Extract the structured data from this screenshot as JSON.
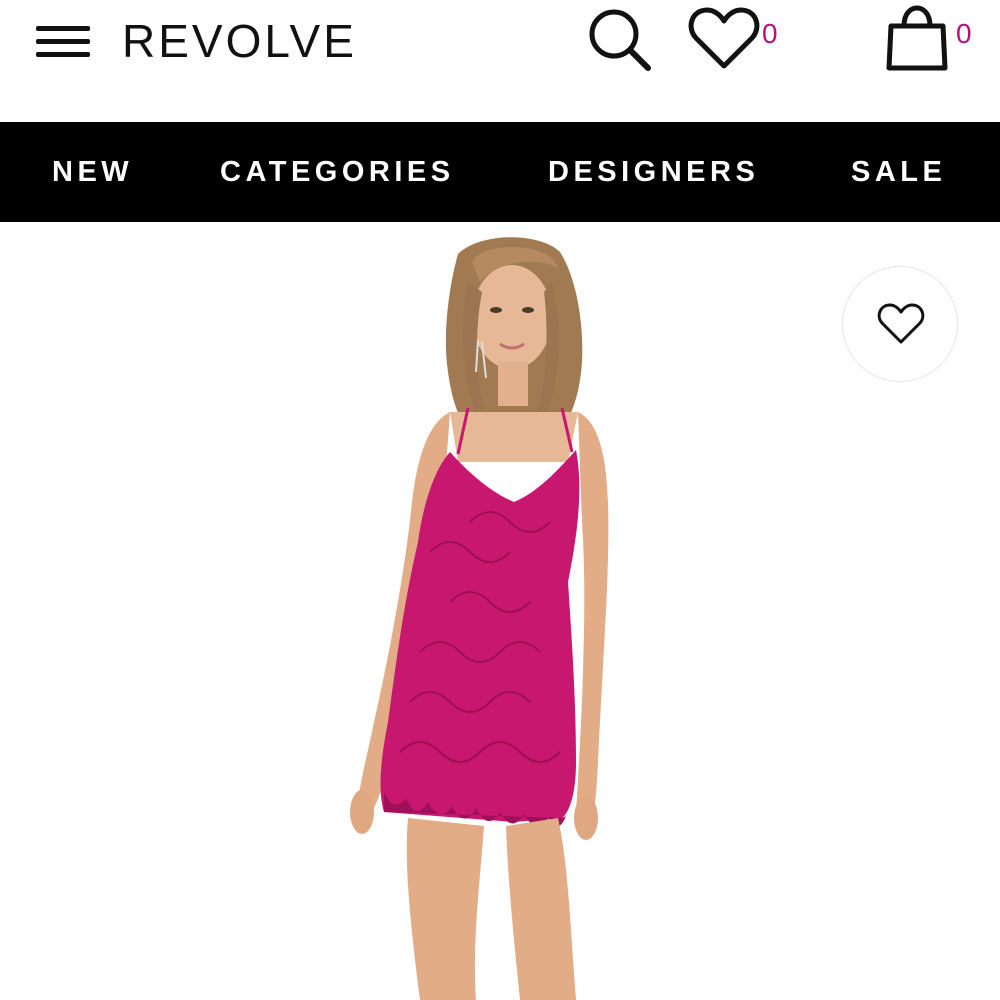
{
  "header": {
    "logo": "REVOLVE",
    "wishlist_count": "0",
    "bag_count": "0",
    "icons": [
      "menu-icon",
      "search-icon",
      "heart-icon",
      "shopping-bag-icon"
    ]
  },
  "nav": {
    "items": [
      {
        "label": "NEW"
      },
      {
        "label": "CATEGORIES"
      },
      {
        "label": "DESIGNERS"
      },
      {
        "label": "SALE"
      }
    ]
  },
  "product": {
    "favorite_icon": "heart-outline-icon",
    "image_subject": "model wearing pink lace mini dress"
  },
  "colors": {
    "accent_count": "#b5117e",
    "navbar_bg": "#000000",
    "dress": "#c8176e"
  }
}
